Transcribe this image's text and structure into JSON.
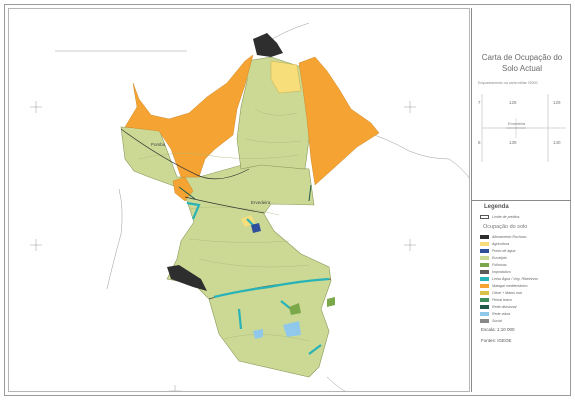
{
  "map": {
    "place_labels": [
      "Pomba",
      "Ervedeira"
    ],
    "index_place_label": "Ervedeira",
    "colors": {
      "eucalipto": "#ccd994",
      "matagal": "#f5a433",
      "agricultura": "#f7de7a",
      "pastagens": "#7ba84a",
      "linhas_agua": "#27b3b8",
      "afloramento": "#2e2e2e",
      "rede_viaria": "#8fc8ea",
      "social": "#888888"
    }
  },
  "panel": {
    "title_line1": "Carta de Ocupação do",
    "title_line2": "Solo Actual",
    "subtitle": "Enquadramento na carta militar 25000",
    "index_grid": {
      "row1_label": "7",
      "row2_label": "8",
      "cells": [
        "128",
        "129",
        "139",
        "140"
      ]
    },
    "legend_title": "Legenda",
    "boundary_label": "Limite de prédios",
    "section_label": "Ocupação do solo",
    "legend_items": [
      {
        "label": "Afloramento Rochoso",
        "color": "#2e2e2e"
      },
      {
        "label": "Agricultura",
        "color": "#f7de7a"
      },
      {
        "label": "Ponto de água",
        "color": "#2f4e9c"
      },
      {
        "label": "Eucalipto",
        "color": "#ccd994"
      },
      {
        "label": "Folhosas",
        "color": "#7ba84a"
      },
      {
        "label": "Improdutivo",
        "color": "#5a5a5a"
      },
      {
        "label": "Linha Água / Veg. Ribeirinha",
        "color": "#27b3b8"
      },
      {
        "label": "Matagal mediterrânico",
        "color": "#f5a433"
      },
      {
        "label": "Olival + Matos mal",
        "color": "#d8c24a"
      },
      {
        "label": "Pinhal bravo",
        "color": "#3f8f5a"
      },
      {
        "label": "Rede divisional",
        "color": "#1f5a4a"
      },
      {
        "label": "Rede viária",
        "color": "#8fc8ea"
      },
      {
        "label": "Social",
        "color": "#888888"
      }
    ],
    "scale": "Escala: 1:10 000",
    "source": "Fontes: IGEOE"
  }
}
